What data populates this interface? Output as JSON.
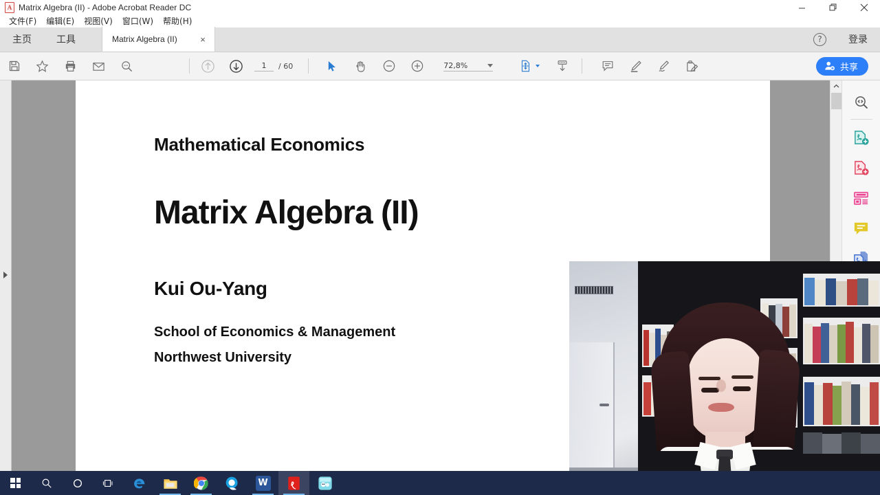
{
  "window": {
    "title": "Matrix Algebra (II) - Adobe Acrobat Reader DC",
    "app_icon": "acrobat-icon",
    "controls": {
      "minimize": "minimize-icon",
      "restore": "restore-icon",
      "close": "close-icon"
    }
  },
  "menubar": {
    "items": [
      {
        "label": "文件(F)",
        "name": "menu-file"
      },
      {
        "label": "编辑(E)",
        "name": "menu-edit"
      },
      {
        "label": "视图(V)",
        "name": "menu-view"
      },
      {
        "label": "窗口(W)",
        "name": "menu-window"
      },
      {
        "label": "帮助(H)",
        "name": "menu-help"
      }
    ]
  },
  "tabstrip": {
    "home_tab": "主页",
    "tools_tab": "工具",
    "document_tab": "Matrix Algebra (II)",
    "document_tab_close": "×",
    "help_glyph": "?",
    "sign_in": "登录"
  },
  "toolbar": {
    "save_icon": "save-icon",
    "bookmark_icon": "star-icon",
    "print_icon": "print-icon",
    "email_icon": "email-icon",
    "search_icon": "search-icon",
    "prev_page_icon": "arrow-up-circle-icon",
    "next_page_icon": "arrow-down-circle-icon",
    "page_current": "1",
    "page_total": "/ 60",
    "select_tool_icon": "cursor-icon",
    "hand_tool_icon": "hand-icon",
    "zoom_out_icon": "minus-circle-icon",
    "zoom_in_icon": "plus-circle-icon",
    "zoom_level": "72,8%",
    "zoom_dropdown_icon": "chevron-down-icon",
    "page_fit_icon": "fit-page-icon",
    "scroll_mode_icon": "scroll-down-icon",
    "comment_icon": "comment-icon",
    "highlight_icon": "highlighter-icon",
    "sign_icon": "sign-icon",
    "fill_sign_icon": "fill-and-sign-icon",
    "share_label": "共享",
    "share_icon": "share-person-icon",
    "accent_color": "#2d7ff9"
  },
  "nav_pane": {
    "expand_icon": "expand-right-arrow-icon"
  },
  "document": {
    "subtitle": "Mathematical Economics",
    "title": "Matrix Algebra (II)",
    "author": "Kui Ou-Yang",
    "affiliation_line1": "School of Economics & Management",
    "affiliation_line2": "Northwest University"
  },
  "scrollbar": {
    "up_icon": "chevron-up-icon",
    "down_icon": "chevron-down-icon",
    "thumb": "scroll-thumb"
  },
  "tool_rail": {
    "items": [
      {
        "name": "enhance-scan-icon",
        "color": "#5a5a5a"
      },
      {
        "name": "export-pdf-icon",
        "color": "#29a39a"
      },
      {
        "name": "create-pdf-icon",
        "color": "#e0455f"
      },
      {
        "name": "organize-pages-icon",
        "color": "#e8408f"
      },
      {
        "name": "comment-icon",
        "color": "#e0c020"
      },
      {
        "name": "combine-files-icon",
        "color": "#3f6fd0"
      }
    ]
  },
  "webcam": {
    "overlay_name": "webcam-video-overlay"
  },
  "taskbar": {
    "background": "#1e2a4a",
    "items": [
      {
        "name": "start-button",
        "label": ""
      },
      {
        "name": "search-button",
        "label": ""
      },
      {
        "name": "cortana-button",
        "label": ""
      },
      {
        "name": "task-view-button",
        "label": ""
      },
      {
        "name": "edge-taskbar-icon",
        "label": "e"
      },
      {
        "name": "file-explorer-taskbar-icon",
        "label": ""
      },
      {
        "name": "chrome-taskbar-icon",
        "label": ""
      },
      {
        "name": "qq-browser-taskbar-icon",
        "label": ""
      },
      {
        "name": "word-taskbar-icon",
        "label": "W"
      },
      {
        "name": "acrobat-taskbar-icon",
        "label": ""
      },
      {
        "name": "other-app-taskbar-icon",
        "label": ""
      }
    ]
  }
}
